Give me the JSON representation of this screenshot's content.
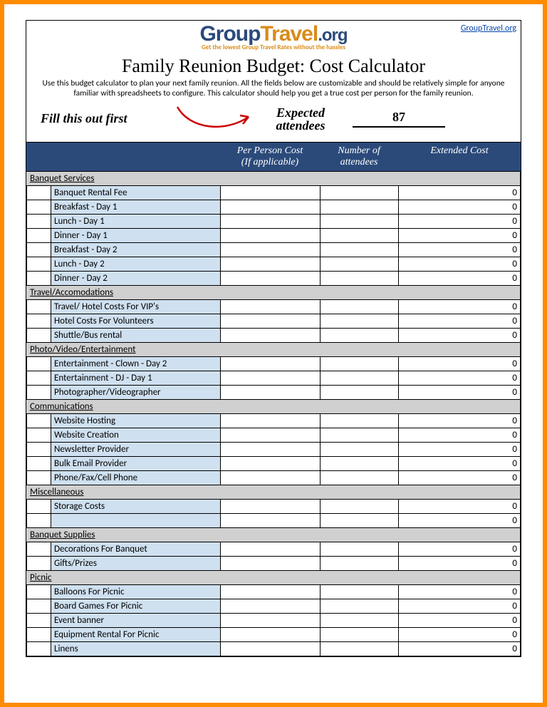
{
  "link_text": "GroupTravel.org",
  "logo": {
    "p1": "Group",
    "p2": "Travel",
    "p3": ".org"
  },
  "tagline": "Get the lowest Group Travel Rates without the hassles",
  "title": "Family Reunion Budget: Cost Calculator",
  "instructions": "Use this budget calculator to plan your next family reunion. All the fields below are customizable and should be relatively simple for anyone familiar with spreadsheets to configure. This calculator should help you get a true cost per person for the family reunion.",
  "fill_first": "Fill this out first",
  "expected_l1": "Expected",
  "expected_l2": "attendees",
  "attendees": "87",
  "colhead": {
    "pp1": "Per Person Cost",
    "pp2": "(If applicable)",
    "na1": "Number of",
    "na2": "attendees",
    "ex": "Extended Cost"
  },
  "sections": [
    {
      "name": "Banquet Services",
      "items": [
        {
          "label": "Banquet Rental Fee",
          "ext": "0"
        },
        {
          "label": "Breakfast - Day 1",
          "ext": "0"
        },
        {
          "label": "Lunch - Day 1",
          "ext": "0"
        },
        {
          "label": "Dinner - Day 1",
          "ext": "0"
        },
        {
          "label": "Breakfast - Day 2",
          "ext": "0"
        },
        {
          "label": "Lunch - Day 2",
          "ext": "0"
        },
        {
          "label": "Dinner - Day 2",
          "ext": "0"
        }
      ]
    },
    {
      "name": "Travel/Accomodations",
      "items": [
        {
          "label": "Travel/ Hotel Costs For VIP's",
          "ext": "0"
        },
        {
          "label": "Hotel Costs For Volunteers",
          "ext": "0"
        },
        {
          "label": "Shuttle/Bus rental",
          "ext": "0"
        }
      ]
    },
    {
      "name": "Photo/Video/Entertainment",
      "items": [
        {
          "label": "Entertainment - Clown - Day 2",
          "ext": "0"
        },
        {
          "label": "Entertainment - DJ - Day 1",
          "ext": "0"
        },
        {
          "label": "Photographer/Videographer",
          "ext": "0"
        }
      ]
    },
    {
      "name": "Communications",
      "items": [
        {
          "label": "Website Hosting",
          "ext": "0"
        },
        {
          "label": "Website Creation",
          "ext": "0"
        },
        {
          "label": "Newsletter Provider",
          "ext": "0"
        },
        {
          "label": "Bulk Email Provider",
          "ext": "0"
        },
        {
          "label": "Phone/Fax/Cell Phone",
          "ext": "0"
        }
      ]
    },
    {
      "name": "Miscellaneous",
      "items": [
        {
          "label": "Storage Costs",
          "ext": "0"
        },
        {
          "label": "",
          "ext": "0"
        }
      ]
    },
    {
      "name": "Banquet Supplies",
      "items": [
        {
          "label": "Decorations For Banquet",
          "ext": "0"
        },
        {
          "label": "Gifts/Prizes",
          "ext": "0"
        }
      ]
    },
    {
      "name": "Picnic",
      "items": [
        {
          "label": "Balloons For Picnic",
          "ext": "0"
        },
        {
          "label": "Board Games For Picnic",
          "ext": "0"
        },
        {
          "label": "Event banner",
          "ext": "0"
        },
        {
          "label": "Equipment Rental For Picnic",
          "ext": "0"
        },
        {
          "label": "Linens",
          "ext": "0"
        }
      ]
    }
  ]
}
